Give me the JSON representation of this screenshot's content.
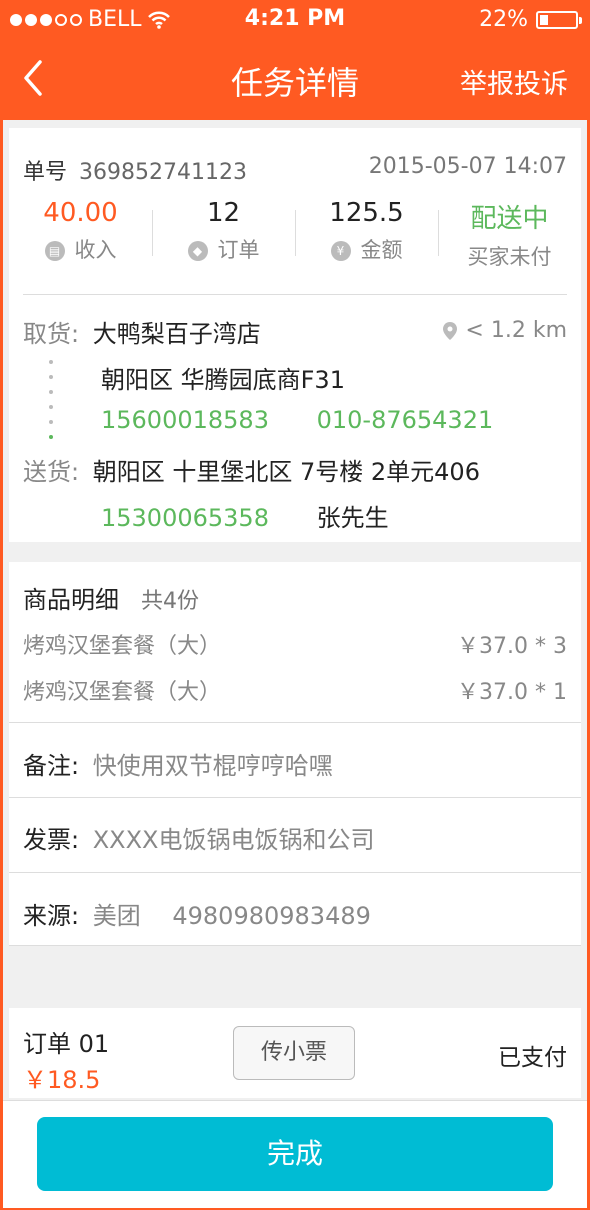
{
  "status_bar": {
    "carrier": "BELL",
    "time": "4:21 PM",
    "battery": "22%"
  },
  "nav": {
    "title": "任务详情",
    "right_action": "举报投诉"
  },
  "order": {
    "label": "单号",
    "number": "369852741123",
    "datetime": "2015-05-07 14:07"
  },
  "stats": [
    {
      "value": "40.00",
      "label": "收入",
      "icon": "wallet-icon"
    },
    {
      "value": "12",
      "label": "订单",
      "icon": "tag-icon"
    },
    {
      "value": "125.5",
      "label": "金额",
      "icon": "yen-icon"
    },
    {
      "value": "配送中",
      "label": "买家未付"
    }
  ],
  "pickup": {
    "label": "取货:",
    "store": "大鸭梨百子湾店",
    "distance": "< 1.2 km",
    "address": "朝阳区 华腾园底商F31",
    "phone1": "15600018583",
    "phone2": "010-87654321"
  },
  "delivery": {
    "label": "送货:",
    "address": "朝阳区 十里堡北区 7号楼 2单元406",
    "phone": "15300065358",
    "name": "张先生"
  },
  "goods": {
    "title": "商品明细",
    "count": "共4份",
    "items": [
      {
        "name": "烤鸡汉堡套餐（大）",
        "price": "￥37.0 * 3"
      },
      {
        "name": "烤鸡汉堡套餐（大）",
        "price": "￥37.0 * 1"
      }
    ]
  },
  "remark": {
    "label": "备注:",
    "value": "快使用双节棍哼哼哈嘿"
  },
  "invoice": {
    "label": "发票:",
    "value": "XXXX电饭锅电饭锅和公司"
  },
  "source": {
    "label": "来源:",
    "value": "美团",
    "code": "4980980983489"
  },
  "sub_order": {
    "title": "订单 01",
    "price": "￥18.5",
    "ticket_button": "传小票",
    "status": "已支付"
  },
  "footer": {
    "done_button": "完成"
  },
  "colors": {
    "brand": "#ff5a22",
    "green": "#5cb85c",
    "primary_button": "#00bcd4"
  }
}
